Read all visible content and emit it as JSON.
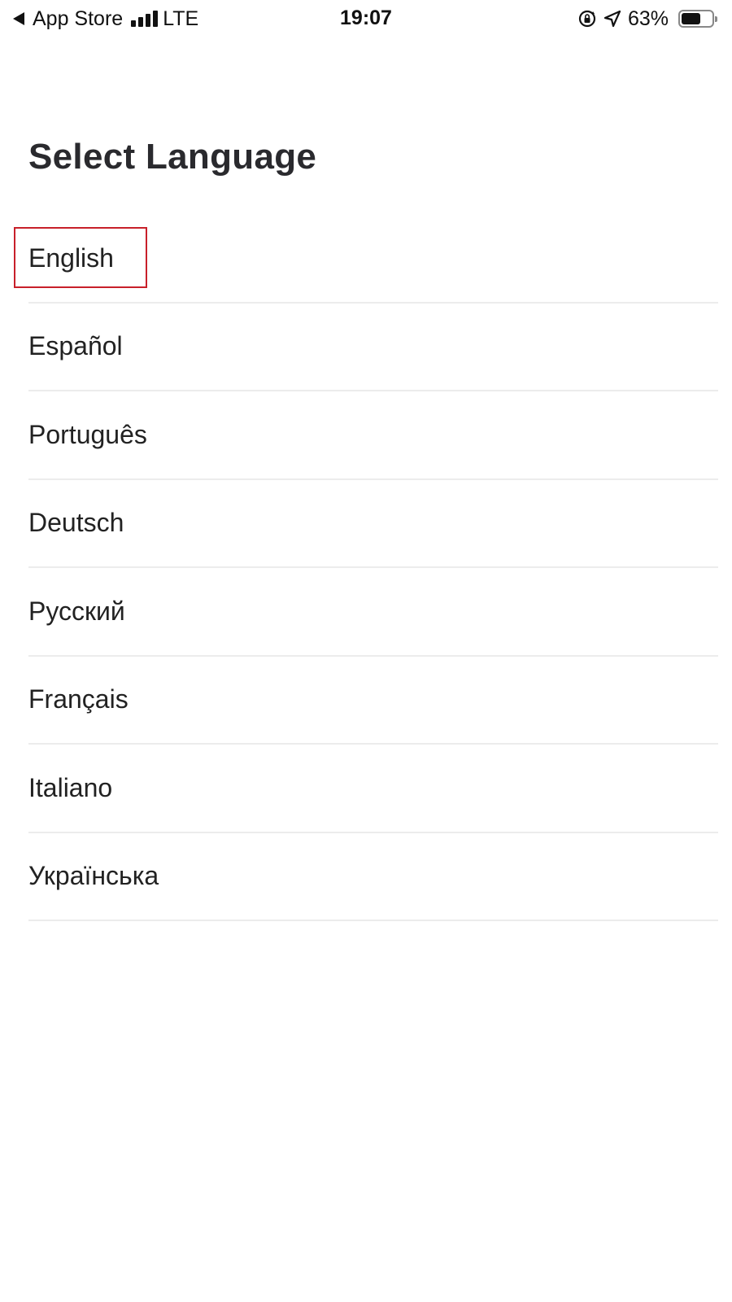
{
  "status_bar": {
    "back_label": "App Store",
    "network": "LTE",
    "time": "19:07",
    "battery_percent_label": "63%",
    "battery_level": 0.63,
    "icons": [
      "back-arrow-icon",
      "signal-icon",
      "rotation-lock-icon",
      "location-arrow-icon",
      "battery-icon"
    ]
  },
  "screen": {
    "title": "Select Language"
  },
  "languages": [
    {
      "label": "English",
      "selected": true
    },
    {
      "label": "Español",
      "selected": false
    },
    {
      "label": "Português",
      "selected": false
    },
    {
      "label": "Deutsch",
      "selected": false
    },
    {
      "label": "Русский",
      "selected": false
    },
    {
      "label": "Français",
      "selected": false
    },
    {
      "label": "Italiano",
      "selected": false
    },
    {
      "label": "Українська",
      "selected": false
    }
  ],
  "colors": {
    "highlight": "#c8202a",
    "divider": "#ececec",
    "text": "#222222"
  }
}
